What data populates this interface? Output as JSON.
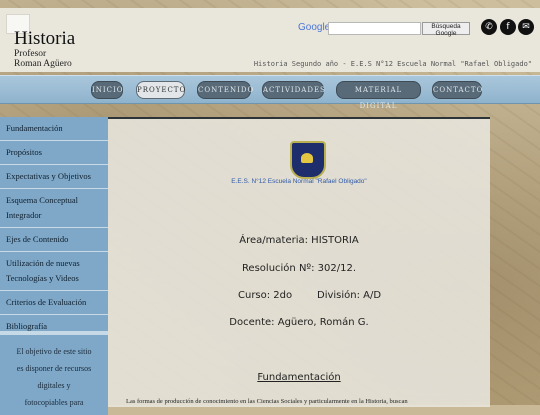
{
  "header": {
    "title": "Historia",
    "subtitle_line1": "Profesor",
    "subtitle_line2": "Roman Agüero",
    "tagline": "Historia Segundo año - E.E.S N°12 Escuela Normal \"Rafael Obligado\"",
    "search": {
      "brand": "Google",
      "placeholder": "",
      "button_label": "Búsqueda Google"
    },
    "social": [
      {
        "name": "whatsapp-icon",
        "glyph": "✆"
      },
      {
        "name": "facebook-icon",
        "glyph": "f"
      },
      {
        "name": "email-icon",
        "glyph": "✉"
      }
    ]
  },
  "nav": {
    "items": [
      {
        "label": "INICIO",
        "active": false
      },
      {
        "label": "PROYECTO",
        "active": true
      },
      {
        "label": "CONTENIDO",
        "active": false
      },
      {
        "label": "ACTIVIDADES",
        "active": false
      },
      {
        "label": "MATERIAL DIGITAL",
        "active": false
      },
      {
        "label": "CONTACTO",
        "active": false
      }
    ]
  },
  "sidebar": {
    "items": [
      {
        "label": "Fundamentación"
      },
      {
        "label": "Propósitos"
      },
      {
        "label": "Expectativas y Objetivos"
      },
      {
        "label": "Esquema Conceptual Integrador"
      },
      {
        "label": "Ejes de Contenido"
      },
      {
        "label": "Utilización de nuevas Tecnologías y Videos"
      },
      {
        "label": "Criterios de Evaluación"
      },
      {
        "label": "Bibliografía"
      }
    ],
    "info_text": "El objetivo de este sitio es disponer de recursos digitales y fotocopiables para"
  },
  "main": {
    "school_name": "E.E.S. N°12 Escuela Normal \"Rafael Obligado\"",
    "area": "Área/materia: HISTORIA",
    "resolution": "Resolución Nº: 302/12.",
    "course": "Curso:  2do",
    "division": "División: A/D",
    "teacher": "Docente: Agüero, Román G.",
    "section_title": "Fundamentación",
    "body_text": "Las formas de producción de conocimiento en las Ciencias Sociales y particularmente en la Historia, buscan"
  },
  "colors": {
    "nav_bar": "#8fb3cc",
    "nav_button": "#586a78",
    "sidebar": "#7fa8c8",
    "accent_link": "#2f5aa8"
  }
}
